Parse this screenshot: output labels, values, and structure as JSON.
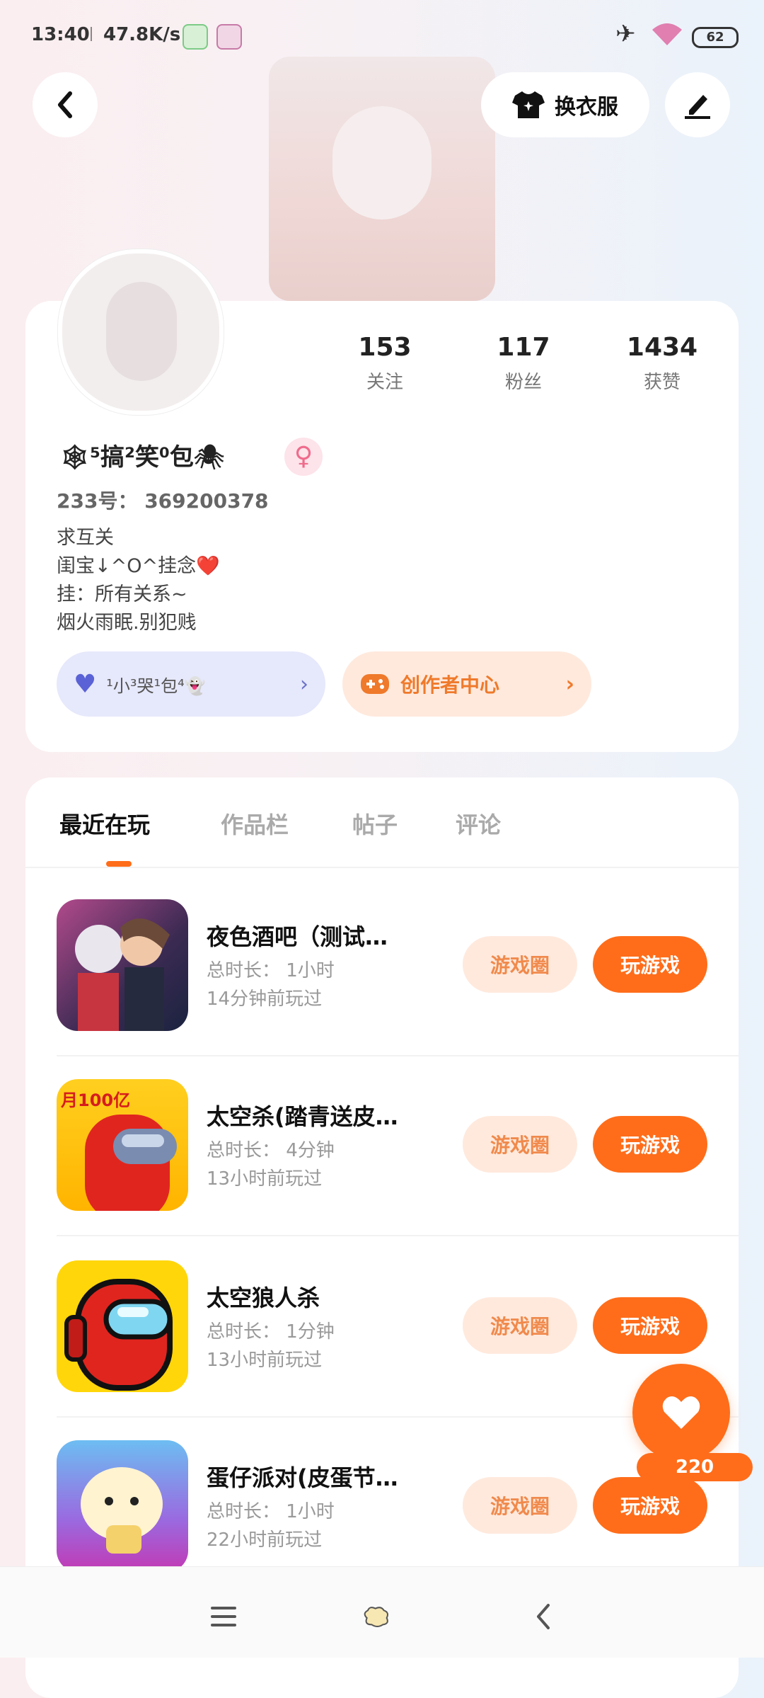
{
  "status_bar": {
    "time": "13:40",
    "net_speed": "47.8K/s",
    "battery": "62"
  },
  "header": {
    "outfit_label": "换衣服"
  },
  "profile": {
    "nickname": "🕸⁵搞²笑⁰包🕷",
    "uid_label": "233号： 369200378",
    "bio": "求互关\n闺宝↓^O^挂念❤️\n挂：所有关系~\n烟火雨眠.别犯贱",
    "fans_pill": "¹小³哭¹包⁴👻",
    "creator_label": "创作者中心"
  },
  "stats": [
    {
      "value": "153",
      "label": "关注"
    },
    {
      "value": "117",
      "label": "粉丝"
    },
    {
      "value": "1434",
      "label": "获赞"
    }
  ],
  "tabs": [
    "最近在玩",
    "作品栏",
    "帖子",
    "评论"
  ],
  "games": [
    {
      "title": "夜色酒吧（测试…",
      "duration": "总时长： 1小时",
      "ago": "14分钟前玩过",
      "circle_label": "游戏圈",
      "play_label": "玩游戏"
    },
    {
      "title": "太空杀(踏青送皮…",
      "duration": "总时长： 4分钟",
      "ago": "13小时前玩过",
      "circle_label": "游戏圈",
      "play_label": "玩游戏",
      "badge": "月100亿"
    },
    {
      "title": "太空狼人杀",
      "duration": "总时长： 1分钟",
      "ago": "13小时前玩过",
      "circle_label": "游戏圈",
      "play_label": "玩游戏"
    },
    {
      "title": "蛋仔派对(皮蛋节…",
      "duration": "总时长： 1小时",
      "ago": "22小时前玩过",
      "circle_label": "游戏圈",
      "play_label": "玩游戏"
    }
  ],
  "like": {
    "count": "220"
  },
  "colors": {
    "accent": "#ff6d1a",
    "accent_light": "#ffe9dd",
    "fans_pill_bg": "#e6e8fb"
  }
}
